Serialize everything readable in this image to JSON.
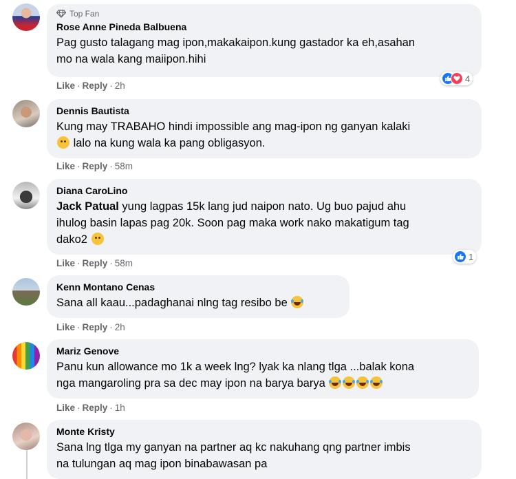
{
  "labels": {
    "like": "Like",
    "reply": "Reply",
    "sep": "·",
    "top_fan": "Top Fan"
  },
  "colors": {
    "bubble": "#f0f2f5",
    "like_blue": "#1877f2",
    "love_red": "#f33e58",
    "meta_gray": "#65676b"
  },
  "comments": [
    {
      "author": "Rose Anne Pineda Balbuena",
      "badge": "Top Fan",
      "line1": "Pag gusto talagang mag ipon,makakaipon.kung gastador ka eh,asahan",
      "line2": "mo na wala kang maiipon.hihi",
      "time": "2h",
      "reaction_count": "4",
      "reaction_icons": [
        "like-icon",
        "love-icon"
      ]
    },
    {
      "author": "Dennis Bautista",
      "line1": "Kung may TRABAHO hindi impossible ang mag-ipon ng ganyan kalaki",
      "line2": "lalo na kung wala ka pang obligasyon.",
      "time": "58m",
      "emoji": "smiling-face-icon"
    },
    {
      "author": "Diana CaroLino",
      "mention": "Jack Patual",
      "line1": "yung lagpas 15k lang jud naipon nato. Ug buo pajud ahu",
      "line2": "ihulog basin lapas pag 20k. Soon pag maka work nako makatigum tag",
      "line3": "dako2",
      "time": "58m",
      "reaction_count": "1",
      "reaction_icons": [
        "like-icon"
      ]
    },
    {
      "author": "Kenn Montano Cenas",
      "line1": "Sana all kaau...padaghanai nlng tag resibo be",
      "time": "2h",
      "emoji": "laughing-tears-icon"
    },
    {
      "author": "Mariz Genove",
      "line1": "Panu kun allowance mo 1k a week lng? lyak ka nlang tlga ...balak kona",
      "line2": "nga mangaroling pra sa dec may ipon na barya barya",
      "time": "1h",
      "emoji": "laughing-tears-icon",
      "emoji_count": 4
    },
    {
      "author": "Monte Kristy",
      "line1": "Sana lng tlga my ganyan na partner aq kc nakuhang qng partner imbis",
      "line2": "na tulungan aq mag ipon binabawasan pa"
    }
  ]
}
